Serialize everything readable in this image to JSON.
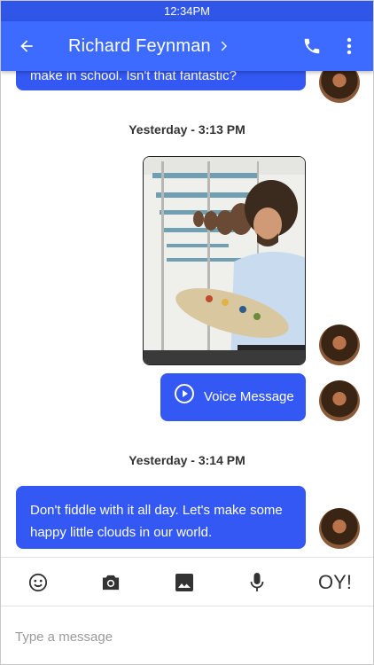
{
  "status_bar": {
    "time": "12:34PM"
  },
  "header": {
    "title": "Richard Feynman",
    "back_icon": "arrow-back-icon",
    "chevron_icon": "chevron-right-icon",
    "call_icon": "phone-icon",
    "menu_icon": "more-vert-icon",
    "color": "#3d6bff"
  },
  "conversation": {
    "partial_message": "make in school. Isn't that fantastic?",
    "groups": [
      {
        "timestamp": "Yesterday - 3:13 PM"
      },
      {
        "timestamp": "Yesterday - 3:14 PM"
      }
    ],
    "voice_message": {
      "label": "Voice Message",
      "icon": "play-circle-icon"
    },
    "last_message": "Don't fiddle with it all day. Let's make some happy little clouds in our world.",
    "bubble_color": "#3358f4"
  },
  "toolbar": {
    "emoji_icon": "emoji-icon",
    "camera_icon": "camera-icon",
    "gallery_icon": "image-icon",
    "mic_icon": "microphone-icon",
    "oy_label": "OY!"
  },
  "composer": {
    "placeholder": "Type a message"
  }
}
